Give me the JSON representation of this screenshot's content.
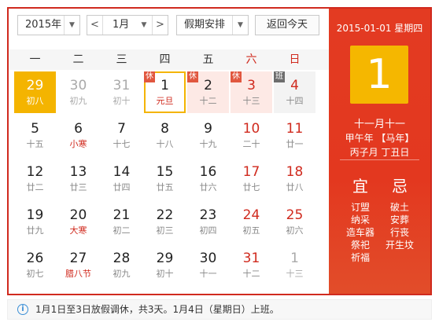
{
  "toolbar": {
    "year_value": "2015年",
    "month_value": "1月",
    "holiday_select": "假期安排",
    "prev_month": "<",
    "next_month": ">",
    "today_button": "返回今天",
    "dropdown_arrow": "▼"
  },
  "weekdays": [
    "一",
    "二",
    "三",
    "四",
    "五",
    "六",
    "日"
  ],
  "weeks": [
    [
      {
        "day": "29",
        "lunar": "初八",
        "state": "selected"
      },
      {
        "day": "30",
        "lunar": "初九",
        "state": "grey"
      },
      {
        "day": "31",
        "lunar": "初十",
        "state": "grey"
      },
      {
        "day": "1",
        "lunar": "元旦",
        "state": "today",
        "tag": "休"
      },
      {
        "day": "2",
        "lunar": "十二",
        "state": "holiday",
        "tag": "休"
      },
      {
        "day": "3",
        "lunar": "十三",
        "state": "holiday-weekend",
        "tag": "休"
      },
      {
        "day": "4",
        "lunar": "十四",
        "state": "workday-weekend",
        "tag": "班"
      }
    ],
    [
      {
        "day": "5",
        "lunar": "十五"
      },
      {
        "day": "6",
        "lunar": "小寒",
        "festival": true
      },
      {
        "day": "7",
        "lunar": "十七"
      },
      {
        "day": "8",
        "lunar": "十八"
      },
      {
        "day": "9",
        "lunar": "十九"
      },
      {
        "day": "10",
        "lunar": "二十",
        "weekend": true
      },
      {
        "day": "11",
        "lunar": "廿一",
        "weekend": true
      }
    ],
    [
      {
        "day": "12",
        "lunar": "廿二"
      },
      {
        "day": "13",
        "lunar": "廿三"
      },
      {
        "day": "14",
        "lunar": "廿四"
      },
      {
        "day": "15",
        "lunar": "廿五"
      },
      {
        "day": "16",
        "lunar": "廿六"
      },
      {
        "day": "17",
        "lunar": "廿七",
        "weekend": true
      },
      {
        "day": "18",
        "lunar": "廿八",
        "weekend": true
      }
    ],
    [
      {
        "day": "19",
        "lunar": "廿九"
      },
      {
        "day": "20",
        "lunar": "大寒",
        "festival": true
      },
      {
        "day": "21",
        "lunar": "初二"
      },
      {
        "day": "22",
        "lunar": "初三"
      },
      {
        "day": "23",
        "lunar": "初四"
      },
      {
        "day": "24",
        "lunar": "初五",
        "weekend": true
      },
      {
        "day": "25",
        "lunar": "初六",
        "weekend": true
      }
    ],
    [
      {
        "day": "26",
        "lunar": "初七"
      },
      {
        "day": "27",
        "lunar": "腊八节",
        "festival": true
      },
      {
        "day": "28",
        "lunar": "初九"
      },
      {
        "day": "29",
        "lunar": "初十"
      },
      {
        "day": "30",
        "lunar": "十一"
      },
      {
        "day": "31",
        "lunar": "十二",
        "weekend": true
      },
      {
        "day": "1",
        "lunar": "十三",
        "state": "grey"
      }
    ]
  ],
  "detail": {
    "date_line": "2015-01-01 星期四",
    "big_day": "1",
    "lunar_date": "十一月十一",
    "ganzhi_year": "甲午年 【马年】",
    "ganzhi_month_day": "丙子月 丁丑日",
    "yi_label": "宜",
    "ji_label": "忌",
    "yi_items": [
      "订盟",
      "纳采",
      "造车器",
      "祭祀",
      "祈福"
    ],
    "ji_items": [
      "破土",
      "安葬",
      "行丧",
      "开生坟"
    ]
  },
  "footer": {
    "info_icon": "i",
    "text": "1月1日至3日放假调休，共3天。1月4日（星期日）上班。"
  },
  "colors": {
    "accent_red": "#d02a1e",
    "highlight_yellow": "#f4b400"
  }
}
